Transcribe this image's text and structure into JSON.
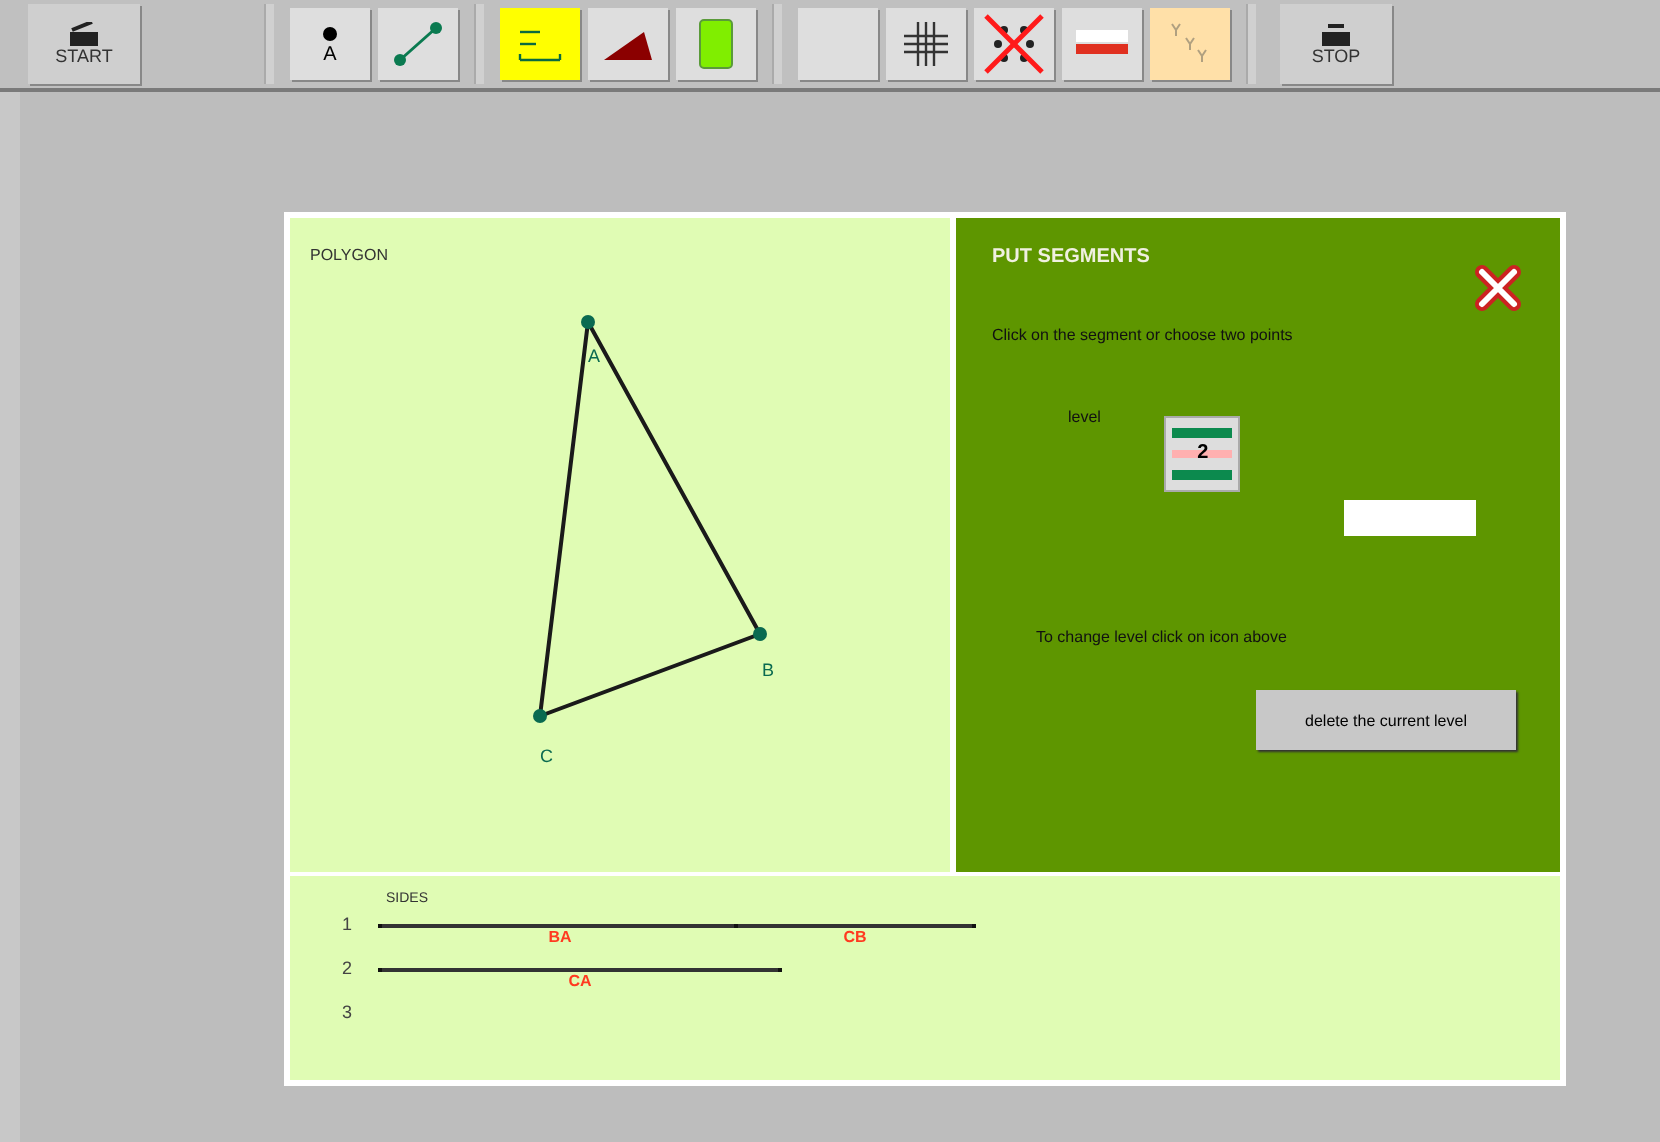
{
  "toolbar": {
    "start": "START",
    "stop": "STOP",
    "tools": [
      {
        "kind": "point",
        "label": "A",
        "selected": false
      },
      {
        "kind": "segment",
        "selected": false
      },
      {
        "kind": "segment-list",
        "selected": true
      },
      {
        "kind": "angle",
        "selected": false
      },
      {
        "kind": "rectangle",
        "selected": false
      },
      {
        "kind": "blank",
        "selected": false
      },
      {
        "kind": "grid",
        "selected": false
      },
      {
        "kind": "no-points",
        "selected": false
      },
      {
        "kind": "bar",
        "selected": false
      },
      {
        "kind": "variables",
        "selected": false
      }
    ]
  },
  "canvas": {
    "title": "POLYGON",
    "vertices": [
      "A",
      "B",
      "C"
    ]
  },
  "panel": {
    "title": "PUT SEGMENTS",
    "instruction": "Click on the segment or choose two points",
    "level_label": "level",
    "level_value": "2",
    "hint": "To change level click on icon above",
    "delete_button": "delete the current level"
  },
  "sides": {
    "title": "SIDES",
    "rows": [
      {
        "number": "1",
        "segments": [
          "BA",
          "CB"
        ]
      },
      {
        "number": "2",
        "segments": [
          "CA"
        ]
      },
      {
        "number": "3",
        "segments": []
      }
    ]
  }
}
